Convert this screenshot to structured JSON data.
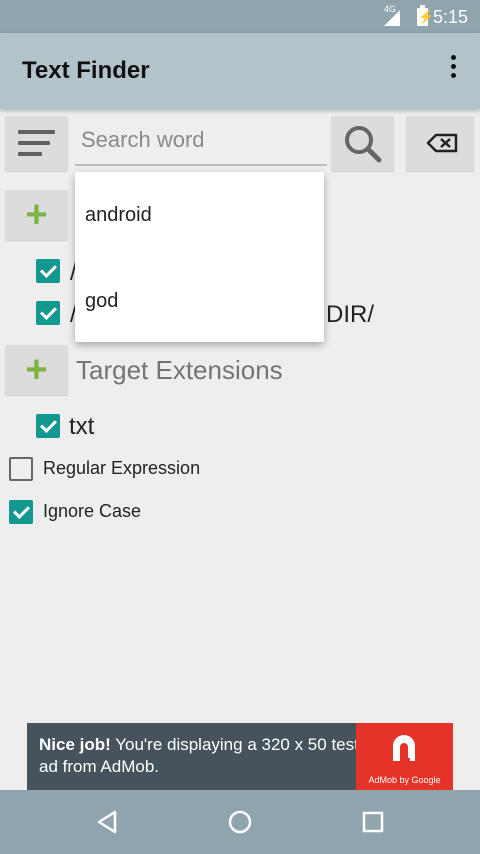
{
  "status_bar": {
    "network": "4G",
    "time": "5:15"
  },
  "app_bar": {
    "title": "Text Finder"
  },
  "search": {
    "placeholder": "Search word",
    "value": ""
  },
  "suggestions": [
    "android",
    "god"
  ],
  "folders": [
    {
      "label": "/",
      "checked": true
    },
    {
      "label": "/",
      "label_tail": "DIR/",
      "checked": true
    }
  ],
  "extensions": {
    "title": "Target Extensions",
    "items": [
      {
        "label": "txt",
        "checked": true
      }
    ]
  },
  "options": {
    "regex_label": "Regular Expression",
    "regex_checked": false,
    "ignore_case_label": "Ignore Case",
    "ignore_case_checked": true
  },
  "ad": {
    "headline": "Nice job!",
    "body": "You're displaying a 320 x 50 test ad from AdMob.",
    "logo_caption": "AdMob by Google"
  },
  "colors": {
    "accent": "#139890",
    "plus": "#7cb342",
    "app_bar": "#b3c3ca",
    "system_bar": "#8fa4ad",
    "ad_bg": "#46535d",
    "ad_logo": "#e6332a"
  },
  "icons": {
    "menu": "hamburger-icon",
    "search": "magnifier-icon",
    "clear": "backspace-icon",
    "more": "overflow-icon",
    "add": "plus-icon"
  }
}
